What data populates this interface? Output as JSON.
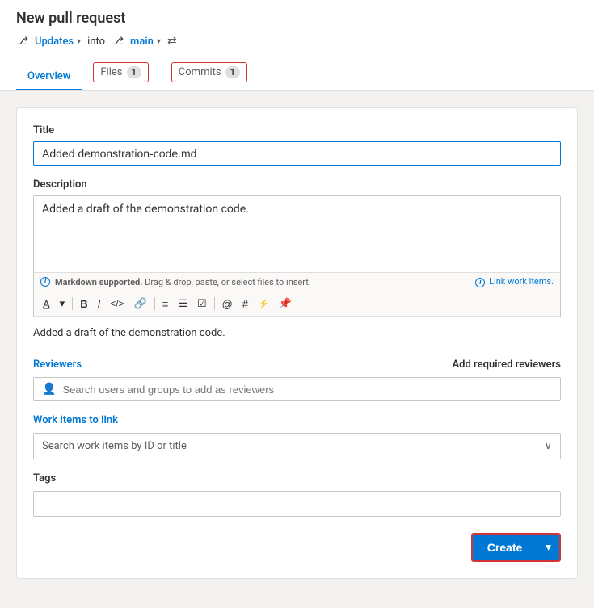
{
  "page": {
    "title": "New pull request"
  },
  "branch_bar": {
    "source_label": "Updates",
    "into_label": "into",
    "target_label": "main",
    "swap_icon": "⇄"
  },
  "tabs": [
    {
      "id": "overview",
      "label": "Overview",
      "badge": null,
      "active": true
    },
    {
      "id": "files",
      "label": "Files",
      "badge": "1",
      "active": false,
      "highlight": true
    },
    {
      "id": "commits",
      "label": "Commits",
      "badge": "1",
      "active": false,
      "highlight": true
    }
  ],
  "form": {
    "title_label": "Title",
    "title_value": "Added demonstration-code.md",
    "description_label": "Description",
    "description_value": "Added a draft of the demonstration code.",
    "markdown_hint": "Markdown supported.",
    "markdown_drag_hint": "Drag & drop, paste, or select files to insert.",
    "link_work_items": "Link work items.",
    "preview_text": "Added a draft of the demonstration code.",
    "toolbar": {
      "buttons": [
        {
          "id": "style",
          "label": "A̲",
          "title": "Text style"
        },
        {
          "id": "chevron",
          "label": "▾",
          "title": "More styles"
        },
        {
          "id": "bold",
          "label": "B",
          "title": "Bold"
        },
        {
          "id": "italic",
          "label": "I",
          "title": "Italic"
        },
        {
          "id": "code",
          "label": "</>",
          "title": "Code"
        },
        {
          "id": "link",
          "label": "🔗",
          "title": "Link"
        },
        {
          "id": "list-ordered",
          "label": "≡",
          "title": "Ordered list"
        },
        {
          "id": "list-unordered",
          "label": "☰",
          "title": "Unordered list"
        },
        {
          "id": "task-list",
          "label": "☑",
          "title": "Task list"
        },
        {
          "id": "mention",
          "label": "@",
          "title": "Mention"
        },
        {
          "id": "heading",
          "label": "#",
          "title": "Heading"
        },
        {
          "id": "pr-ref",
          "label": "⚡",
          "title": "PR reference"
        },
        {
          "id": "attachment",
          "label": "📎",
          "title": "Attach"
        }
      ]
    },
    "reviewers_label": "Reviewers",
    "add_reviewers_label": "Add required reviewers",
    "reviewers_placeholder": "Search users and groups to add as reviewers",
    "work_items_label": "Work items to link",
    "work_items_placeholder": "Search work items by ID or title",
    "tags_label": "Tags",
    "tags_value": ""
  },
  "actions": {
    "create_label": "Create",
    "dropdown_arrow": "▾"
  },
  "colors": {
    "primary": "#0078d4",
    "danger": "#d13438",
    "active_tab": "#0078d4"
  }
}
